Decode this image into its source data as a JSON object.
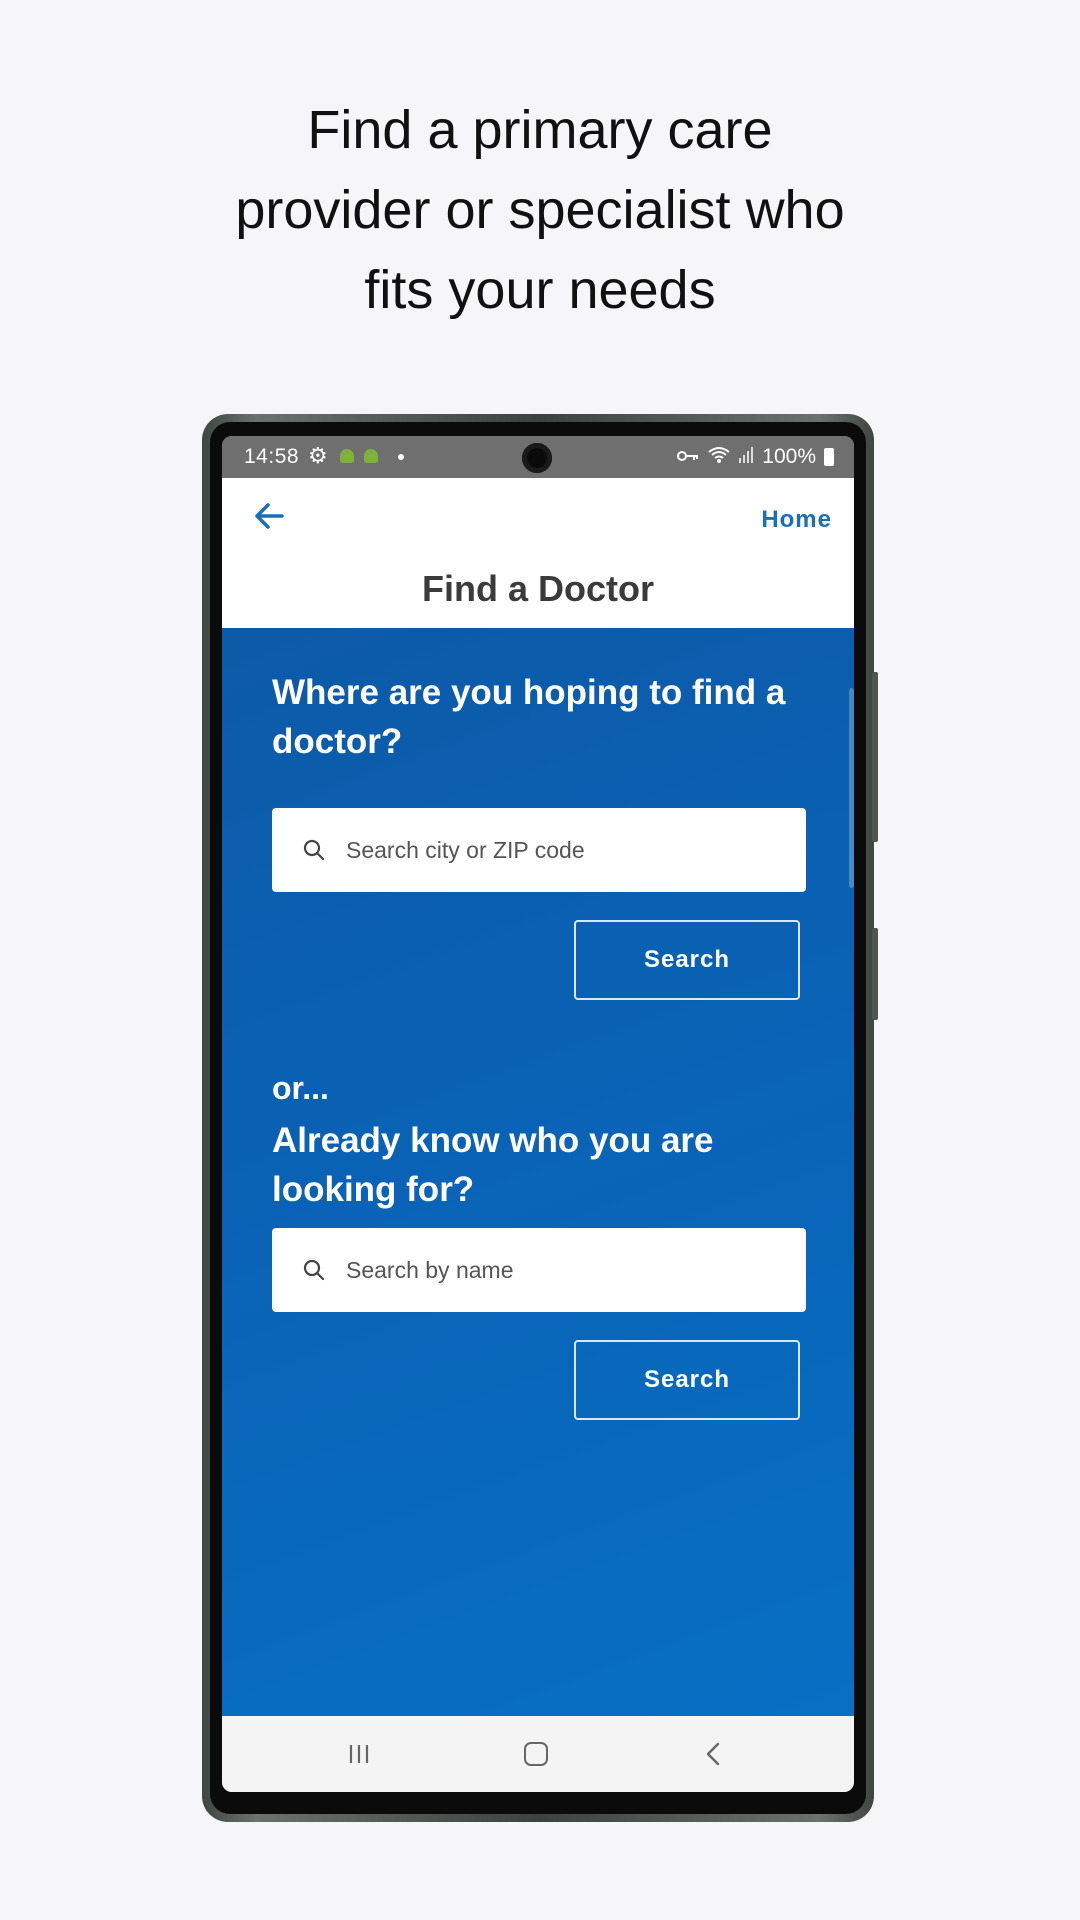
{
  "headline": {
    "lines": [
      "Find a primary care",
      "provider or specialist who",
      "fits your needs"
    ]
  },
  "status_bar": {
    "time": "14:58",
    "battery": "100%",
    "icons": [
      "gear-icon",
      "android-icon",
      "android-icon",
      "dot-icon",
      "key-icon",
      "wifi-icon",
      "signal-icon",
      "battery-icon"
    ]
  },
  "header": {
    "back_icon": "arrow-left-icon",
    "home_label": "Home",
    "title": "Find a Doctor"
  },
  "location_search": {
    "question": "Where are you hoping to find a doctor?",
    "placeholder": "Search city or ZIP code",
    "value": "",
    "button_label": "Search"
  },
  "name_search": {
    "or_label": "or...",
    "question": "Already know who you are looking for?",
    "placeholder": "Search by name",
    "value": "",
    "button_label": "Search"
  },
  "nav_bar": {
    "icons": [
      "recent-apps-icon",
      "home-icon",
      "back-icon"
    ]
  },
  "colors": {
    "accent": "#1a6fb5",
    "background_blue": "#0a61b4",
    "page_background": "#f6f6f8"
  }
}
